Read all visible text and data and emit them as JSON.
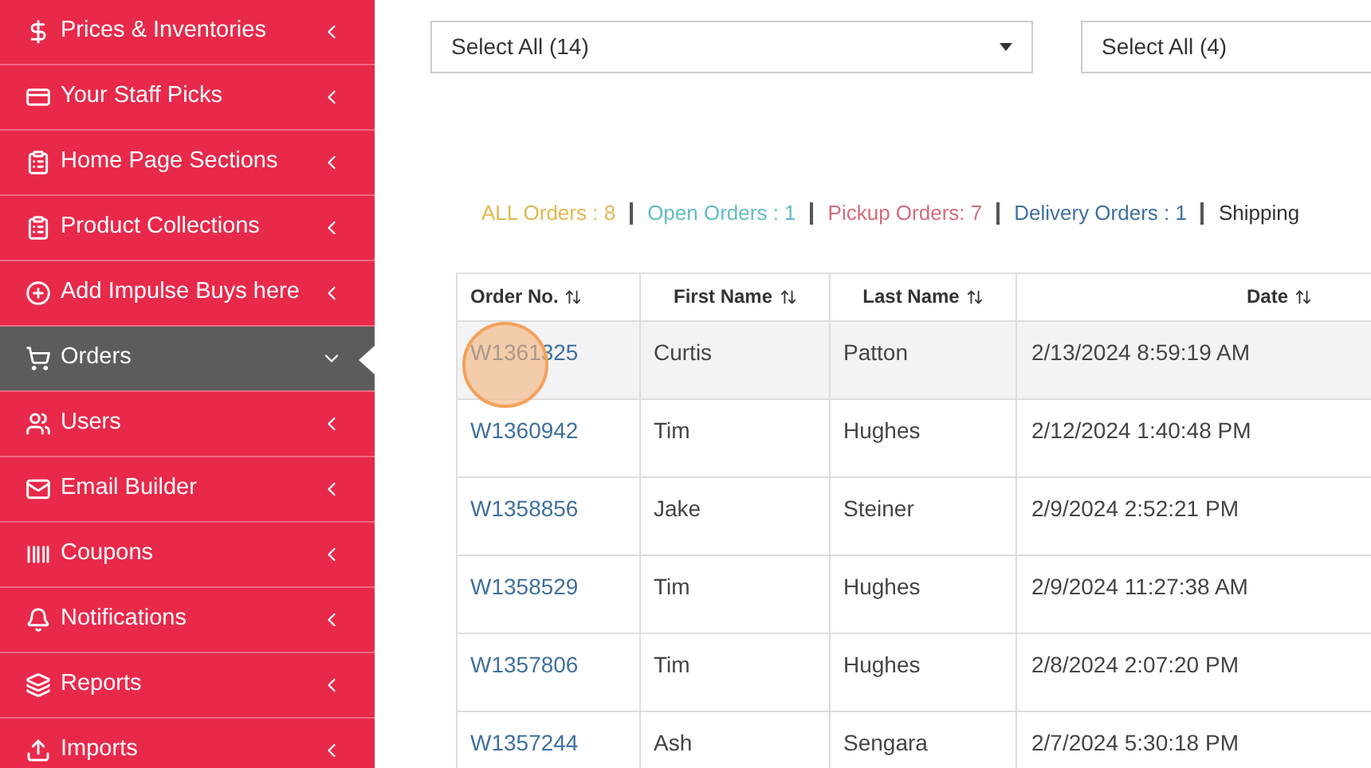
{
  "sidebar": {
    "items": [
      {
        "label": "Prices & Inventories",
        "selected": false
      },
      {
        "label": "Your Staff Picks",
        "selected": false
      },
      {
        "label": "Home Page Sections",
        "selected": false
      },
      {
        "label": "Product Collections",
        "selected": false
      },
      {
        "label": "Add Impulse Buys here",
        "selected": false
      },
      {
        "label": "Orders",
        "selected": true
      },
      {
        "label": "Users",
        "selected": false
      },
      {
        "label": "Email Builder",
        "selected": false
      },
      {
        "label": "Coupons",
        "selected": false
      },
      {
        "label": "Notifications",
        "selected": false
      },
      {
        "label": "Reports",
        "selected": false
      },
      {
        "label": "Imports",
        "selected": false
      }
    ]
  },
  "filters": [
    {
      "value": "Select All (14)"
    },
    {
      "value": "Select All (4)"
    }
  ],
  "tabs": [
    {
      "label": "ALL Orders : 8",
      "color": "#e0b84e",
      "selected": false
    },
    {
      "label": "Open Orders : 1",
      "color": "#62bcc4",
      "selected": false
    },
    {
      "label": "Pickup Orders: 7",
      "color": "#d66a7c",
      "selected": false
    },
    {
      "label": "Delivery Orders : 1",
      "color": "#3f6f9f",
      "selected": false
    },
    {
      "label": "Shipping",
      "color": "#333333",
      "selected": false
    }
  ],
  "table": {
    "columns": [
      "Order No.",
      "First Name",
      "Last Name",
      "Date"
    ],
    "rows": [
      {
        "cells": [
          "W1361325",
          "Curtis",
          "Patton",
          "2/13/2024 8:59:19 AM"
        ],
        "selected": true
      },
      {
        "cells": [
          "W1360942",
          "Tim",
          "Hughes",
          "2/12/2024 1:40:48 PM"
        ],
        "selected": false
      },
      {
        "cells": [
          "W1358856",
          "Jake",
          "Steiner",
          "2/9/2024 2:52:21 PM"
        ],
        "selected": false
      },
      {
        "cells": [
          "W1358529",
          "Tim",
          "Hughes",
          "2/9/2024 11:27:38 AM"
        ],
        "selected": false
      },
      {
        "cells": [
          "W1357806",
          "Tim",
          "Hughes",
          "2/8/2024 2:07:20 PM"
        ],
        "selected": false
      },
      {
        "cells": [
          "W1357244",
          "Ash",
          "Sengara",
          "2/7/2024 5:30:18 PM"
        ],
        "selected": false
      }
    ]
  }
}
